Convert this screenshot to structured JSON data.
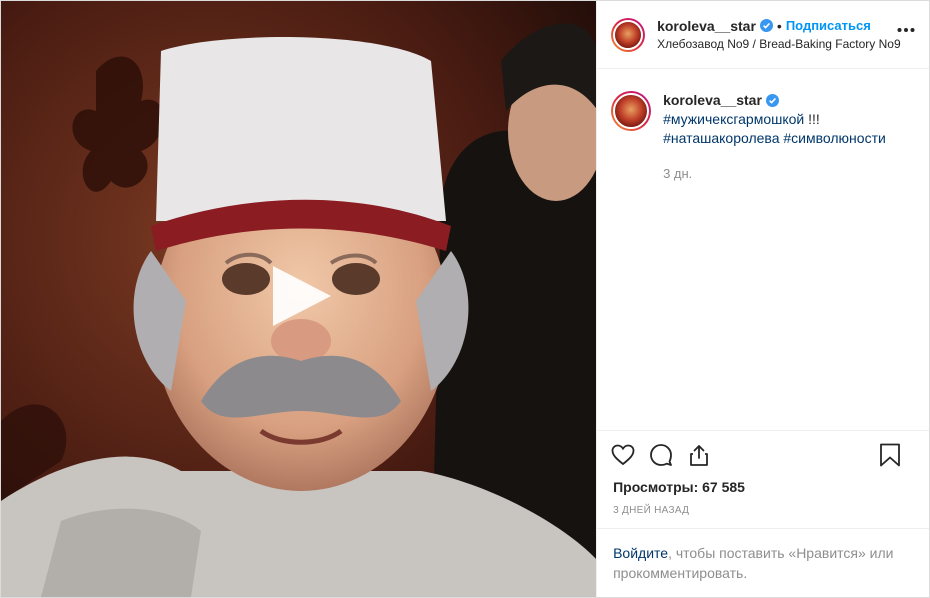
{
  "header": {
    "username": "koroleva__star",
    "separator": "•",
    "follow_label": "Подписаться",
    "location": "Хлебозавод No9 / Bread-Baking Factory No9",
    "more_icon": "more-horizontal-icon"
  },
  "caption": {
    "username": "koroleva__star",
    "line1": "#мужичексгармошкой",
    "line1_suffix": " !!!",
    "tag2": "#наташакоролева",
    "tag3": "#символюности",
    "time": "3 дн."
  },
  "actions": {
    "like_icon": "heart-icon",
    "comment_icon": "comment-icon",
    "share_icon": "share-icon",
    "save_icon": "bookmark-icon"
  },
  "stats": {
    "views_label": "Просмотры:",
    "views_value": "67 585",
    "posted_ago": "3 ДНЕЙ НАЗАД"
  },
  "login_prompt": {
    "link": "Войдите",
    "text": ", чтобы поставить «Нравится» или прокомментировать."
  },
  "colors": {
    "accent": "#0095f6",
    "hashtag": "#00376b",
    "muted": "#8e8e8e"
  }
}
